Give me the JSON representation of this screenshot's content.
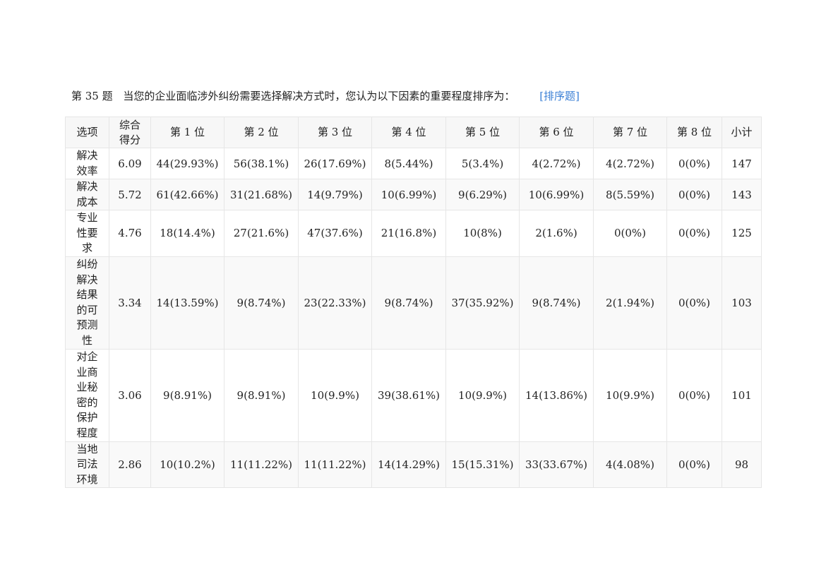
{
  "question": {
    "number": "第 35 题",
    "title": "当您的企业面临涉外纠纷需要选择解决方式时，您认为以下因素的重要程度排序为：",
    "type": "[排序题]"
  },
  "table": {
    "headers": [
      "选项",
      "综合得分",
      "第 1 位",
      "第 2 位",
      "第 3 位",
      "第 4 位",
      "第 5 位",
      "第 6 位",
      "第 7 位",
      "第 8 位",
      "小计"
    ],
    "rows": [
      {
        "option": "解决效率",
        "score": "6.09",
        "ranks": [
          "44(29.93%)",
          "56(38.1%)",
          "26(17.69%)",
          "8(5.44%)",
          "5(3.4%)",
          "4(2.72%)",
          "4(2.72%)",
          "0(0%)"
        ],
        "total": "147"
      },
      {
        "option": "解决成本",
        "score": "5.72",
        "ranks": [
          "61(42.66%)",
          "31(21.68%)",
          "14(9.79%)",
          "10(6.99%)",
          "9(6.29%)",
          "10(6.99%)",
          "8(5.59%)",
          "0(0%)"
        ],
        "total": "143"
      },
      {
        "option": "专业性要求",
        "score": "4.76",
        "ranks": [
          "18(14.4%)",
          "27(21.6%)",
          "47(37.6%)",
          "21(16.8%)",
          "10(8%)",
          "2(1.6%)",
          "0(0%)",
          "0(0%)"
        ],
        "total": "125"
      },
      {
        "option": "纠纷解决结果的可预测性",
        "score": "3.34",
        "ranks": [
          "14(13.59%)",
          "9(8.74%)",
          "23(22.33%)",
          "9(8.74%)",
          "37(35.92%)",
          "9(8.74%)",
          "2(1.94%)",
          "0(0%)"
        ],
        "total": "103"
      },
      {
        "option": "对企业商业秘密的保护程度",
        "score": "3.06",
        "ranks": [
          "9(8.91%)",
          "9(8.91%)",
          "10(9.9%)",
          "39(38.61%)",
          "10(9.9%)",
          "14(13.86%)",
          "10(9.9%)",
          "0(0%)"
        ],
        "total": "101"
      },
      {
        "option": "当地司法环境",
        "score": "2.86",
        "ranks": [
          "10(10.2%)",
          "11(11.22%)",
          "11(11.22%)",
          "14(14.29%)",
          "15(15.31%)",
          "33(33.67%)",
          "4(4.08%)",
          "0(0%)"
        ],
        "total": "98"
      }
    ]
  }
}
